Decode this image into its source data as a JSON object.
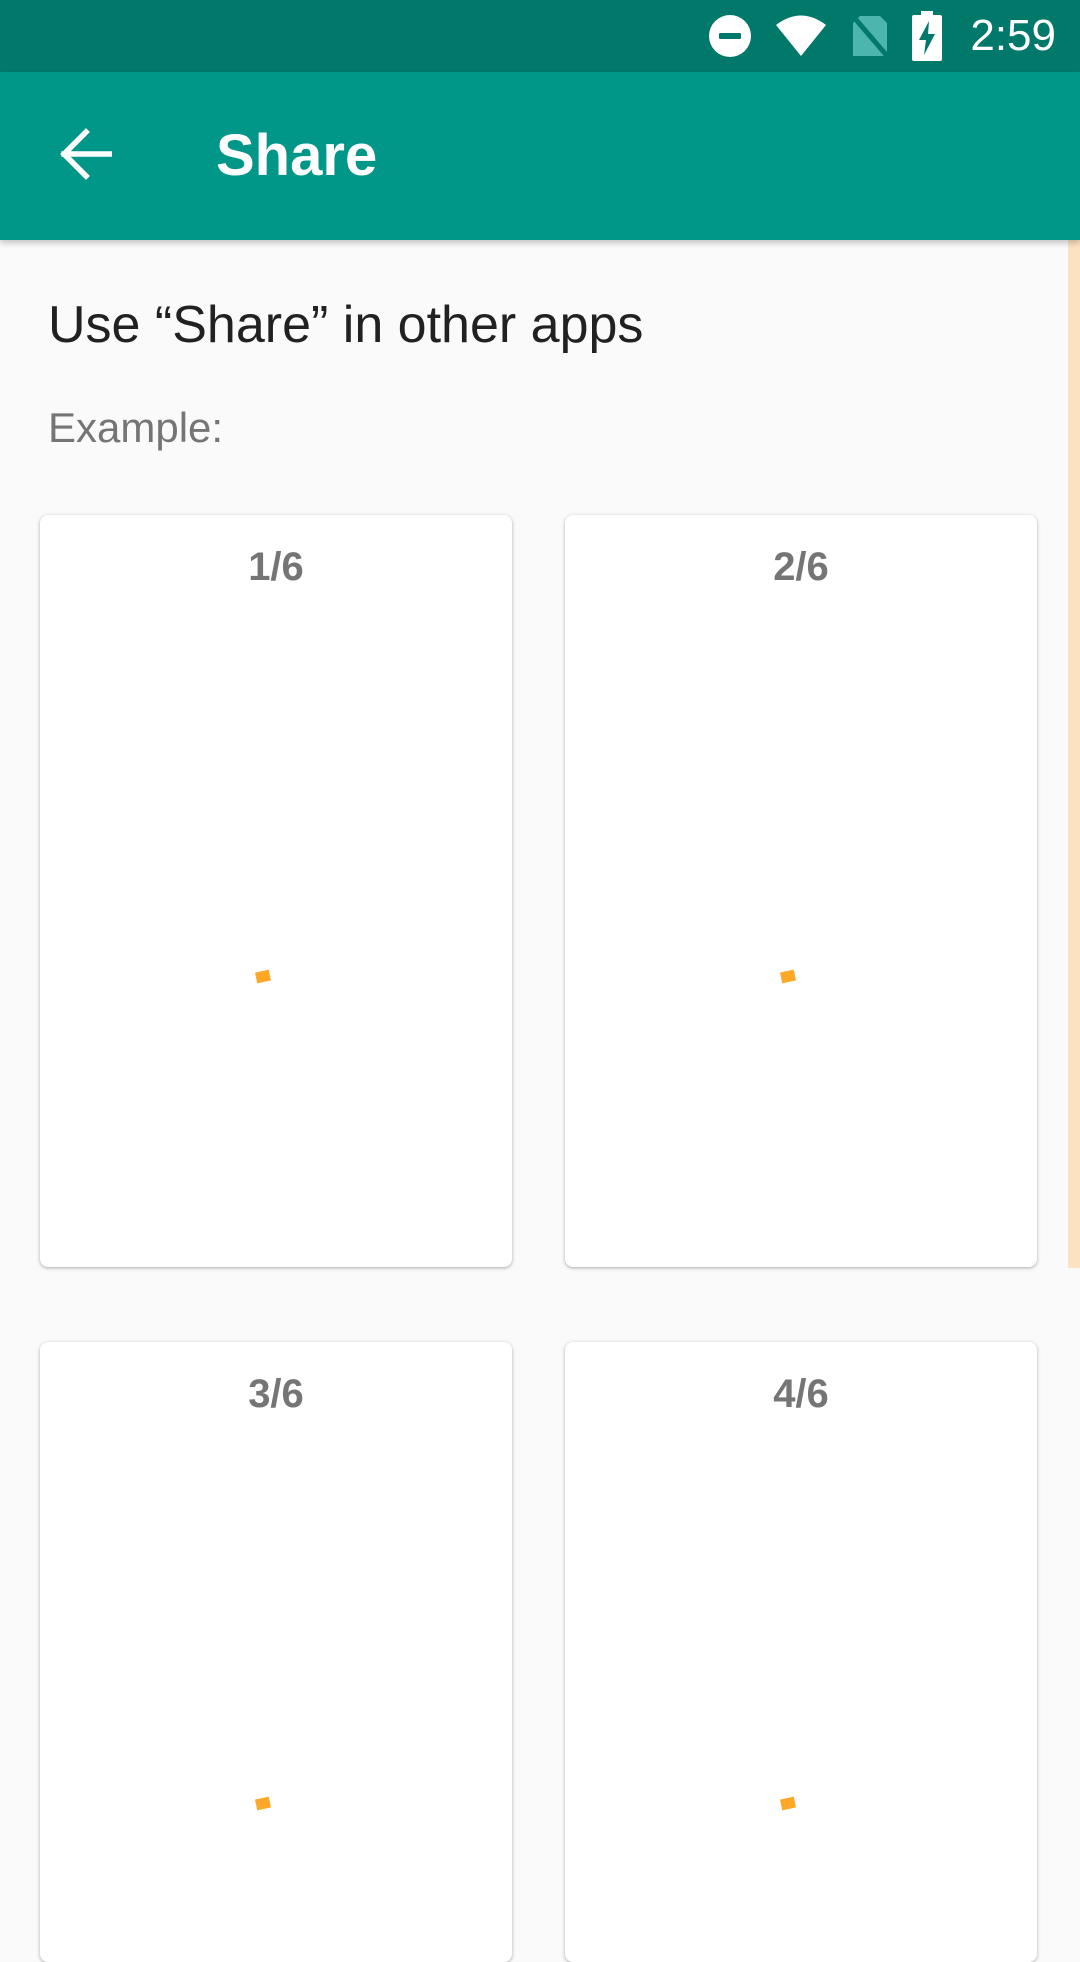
{
  "status_bar": {
    "time": "2:59",
    "icons": [
      "do-not-disturb-icon",
      "wifi-icon",
      "no-sim-icon",
      "battery-charging-icon"
    ]
  },
  "app_bar": {
    "title": "Share",
    "back_icon": "arrow-back-icon"
  },
  "content": {
    "heading": "Use “Share” in other apps",
    "subheading": "Example:",
    "cards": [
      {
        "label": "1/6"
      },
      {
        "label": "2/6"
      },
      {
        "label": "3/6"
      },
      {
        "label": "4/6"
      }
    ]
  },
  "colors": {
    "status_bar": "#00796b",
    "app_bar": "#009688",
    "accent": "#ffa726",
    "background": "#fafafa"
  }
}
